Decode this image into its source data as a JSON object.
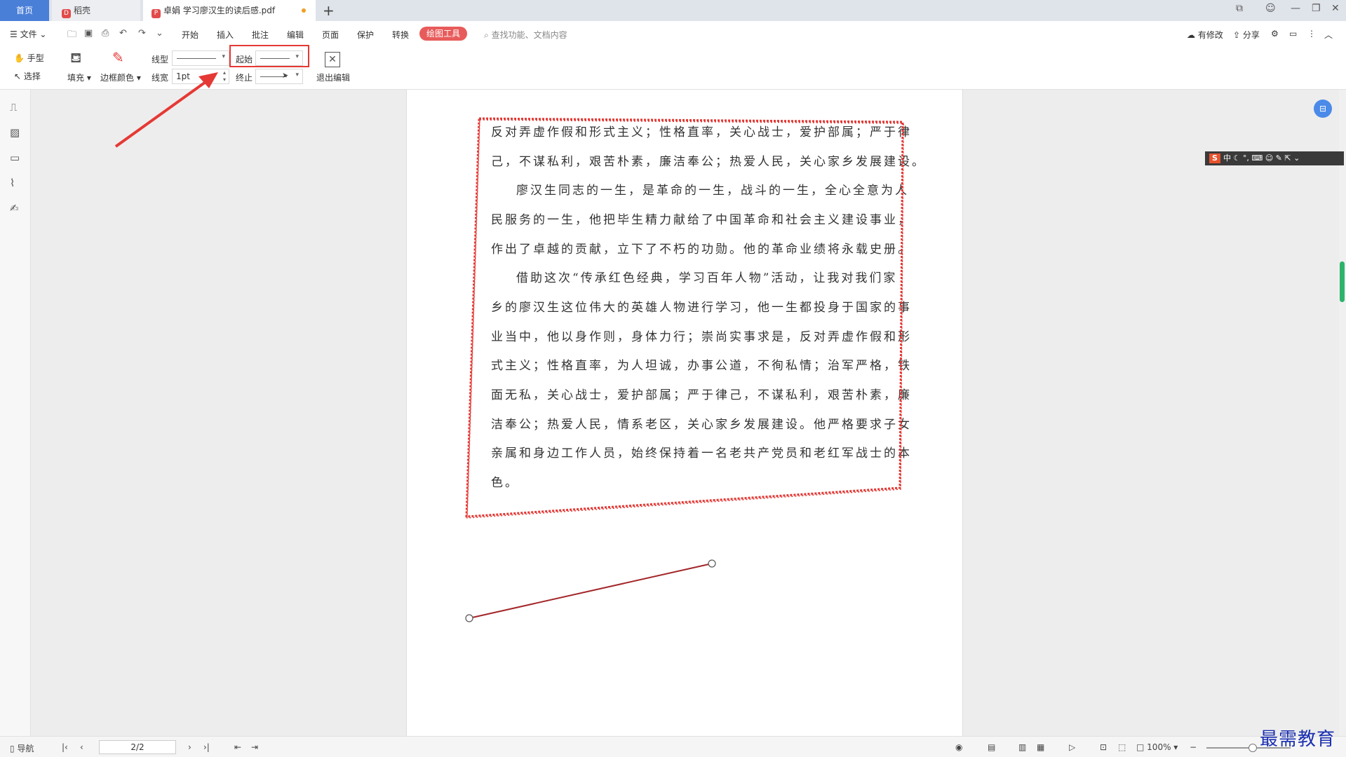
{
  "tabs": {
    "home": "首页",
    "daoke": "稻壳",
    "doc": "卓娟 学习廖汉生的读后感.pdf",
    "add": "+"
  },
  "menubar": {
    "file": "文件",
    "items": [
      "开始",
      "插入",
      "批注",
      "编辑",
      "页面",
      "保护",
      "转换"
    ],
    "active": "绘图工具",
    "search": "查找功能、文档内容",
    "right": {
      "modified": "有修改",
      "share": "分享"
    }
  },
  "ribbon": {
    "hand": "手型",
    "select": "选择",
    "fill": "填充",
    "border_color": "边框颜色",
    "line_type": "线型",
    "line_width": "线宽",
    "line_width_value": "1pt",
    "start": "起始",
    "end": "终止",
    "exit_edit": "退出编辑"
  },
  "document": {
    "lines": [
      "反对弄虚作假和形式主义；性格直率，关心战士，爱护部属；严于律",
      "己，不谋私利，艰苦朴素，廉洁奉公；热爱人民，关心家乡发展建设。",
      "廖汉生同志的一生，是革命的一生，战斗的一生，全心全意为人",
      "民服务的一生，他把毕生精力献给了中国革命和社会主义建设事业，",
      "作出了卓越的贡献，立下了不朽的功勋。他的革命业绩将永载史册。",
      "借助这次“传承红色经典，学习百年人物”活动，让我对我们家",
      "乡的廖汉生这位伟大的英雄人物进行学习，他一生都投身于国家的事",
      "业当中，他以身作则，身体力行；崇尚实事求是，反对弄虚作假和形",
      "式主义；性格直率，为人坦诚，办事公道，不徇私情；治军严格，铁",
      "面无私，关心战士，爱护部属；严于律己，不谋私利，艰苦朴素，廉",
      "洁奉公；热爱人民，情系老区，关心家乡发展建设。他严格要求子女",
      "亲属和身边工作人员，始终保持着一名老共产党员和老红军战士的本",
      "色。"
    ]
  },
  "statusbar": {
    "nav": "导航",
    "page": "2/2",
    "zoom": "100%"
  },
  "ime": {
    "label": "中"
  },
  "watermark": "最需教育",
  "colors": {
    "accent": "#e85b5b",
    "annotation": "#e53935",
    "home_tab": "#4a7fd8",
    "scroll_thumb": "#2db36b"
  }
}
